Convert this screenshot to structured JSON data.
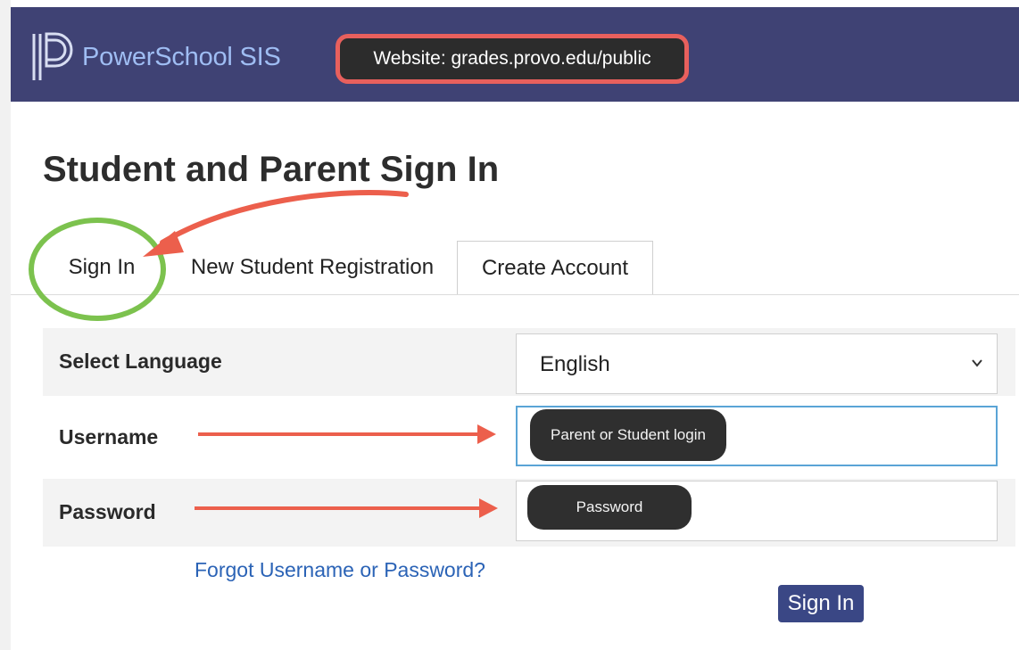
{
  "header": {
    "brand": "PowerSchool SIS",
    "website_callout": "Website:  grades.provo.edu/public"
  },
  "page": {
    "title": "Student and Parent Sign In"
  },
  "tabs": [
    {
      "label": "Sign In",
      "active": true
    },
    {
      "label": "New Student Registration",
      "active": false
    },
    {
      "label": "Create Account",
      "active": false
    }
  ],
  "form": {
    "language": {
      "label": "Select Language",
      "selected": "English"
    },
    "username": {
      "label": "Username",
      "hint": "Parent or Student login"
    },
    "password": {
      "label": "Password",
      "hint": "Password"
    },
    "forgot_link": "Forgot Username or Password?",
    "submit_label": "Sign In"
  },
  "colors": {
    "header_bg": "#3f4274",
    "brand_text": "#9fbdf3",
    "callout_border": "#e8605d",
    "annotation_arrow": "#ec5f4c",
    "annotation_circle": "#7cc24e",
    "link": "#2b63b6",
    "button_bg": "#3a4785"
  }
}
